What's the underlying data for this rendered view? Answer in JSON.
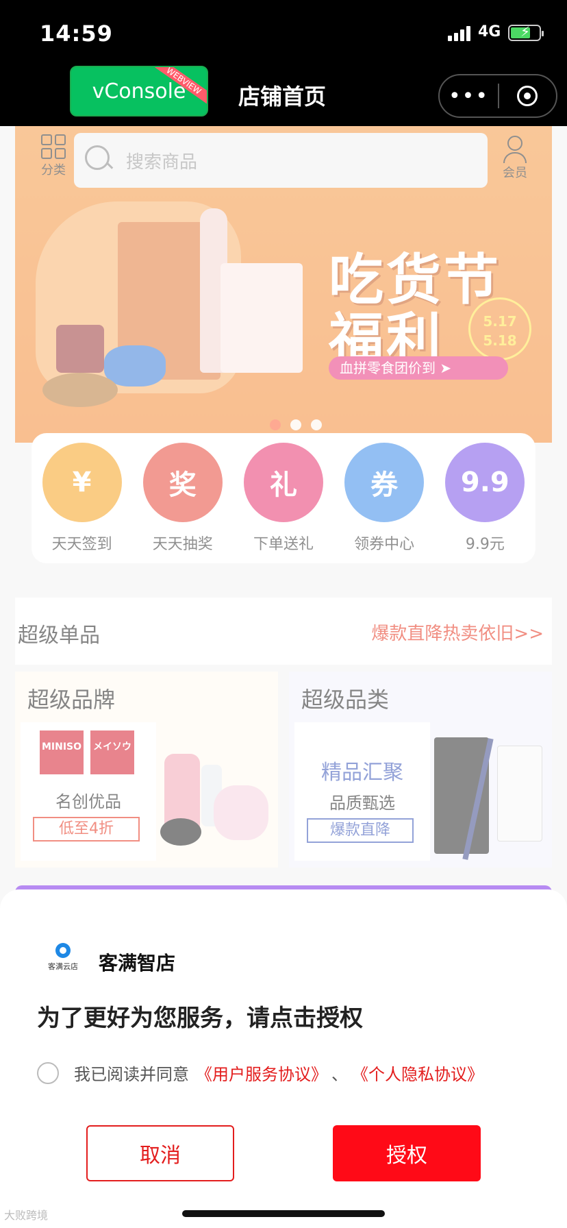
{
  "status": {
    "time": "14:59",
    "network": "4G"
  },
  "nav": {
    "vconsole_label": "vConsole",
    "webview_tag": "WEBVIEW",
    "title": "店铺首页"
  },
  "search": {
    "category_label": "分类",
    "placeholder": "搜索商品",
    "member_label": "会员"
  },
  "banner": {
    "headline1": "吃货节",
    "headline2": "福利",
    "date_start": "5.17",
    "date_end": "5.18",
    "pill_text": "血拼零食团价到 ➤"
  },
  "quick_entries": [
    {
      "label": "天天签到",
      "glyph": "¥",
      "color": "#f6a31f"
    },
    {
      "label": "天天抽奖",
      "glyph": "奖",
      "color": "#e8473a"
    },
    {
      "label": "下单送礼",
      "glyph": "礼",
      "color": "#e8356f"
    },
    {
      "label": "领券中心",
      "glyph": "券",
      "color": "#3b8bea"
    },
    {
      "label": "9.9元",
      "glyph": "9.9",
      "color": "#7a52e8"
    }
  ],
  "super_single": {
    "title": "超级单品",
    "link": "爆款直降热卖依旧>>"
  },
  "brand_card": {
    "title": "超级品牌",
    "logo1": "MINISO",
    "logo2": "メイソウ",
    "name": "名创优品",
    "tag": "低至4折"
  },
  "category_card": {
    "title": "超级品类",
    "headline": "精品汇聚",
    "sub": "品质甄选",
    "tag": "爆款直降"
  },
  "sheet": {
    "app_name": "客满智店",
    "logo_text": "客满云店",
    "title": "为了更好为您服务，请点击授权",
    "agree_text": "我已阅读并同意",
    "link1": "《用户服务协议》",
    "separator": "、",
    "link2": "《个人隐私协议》",
    "cancel_label": "取消",
    "confirm_label": "授权"
  },
  "watermark": "大败跨境",
  "colors": {
    "accent_red": "#e31d1d",
    "confirm_red": "#ff0a17",
    "vconsole_green": "#07c160"
  }
}
